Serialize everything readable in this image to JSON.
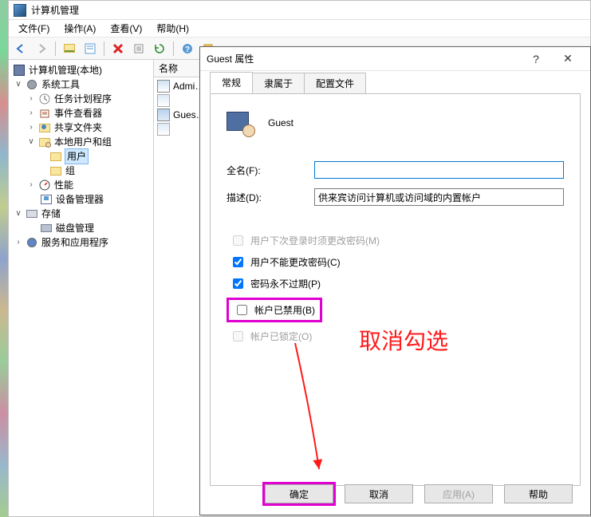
{
  "window": {
    "title": "计算机管理"
  },
  "menu": {
    "file": "文件(F)",
    "action": "操作(A)",
    "view": "查看(V)",
    "help": "帮助(H)"
  },
  "tree": {
    "root": "计算机管理(本地)",
    "system_tools": "系统工具",
    "task_scheduler": "任务计划程序",
    "event_viewer": "事件查看器",
    "shared_folders": "共享文件夹",
    "local_users_groups": "本地用户和组",
    "users": "用户",
    "groups": "组",
    "performance": "性能",
    "device_manager": "设备管理器",
    "storage": "存储",
    "disk_mgmt": "磁盘管理",
    "services_apps": "服务和应用程序"
  },
  "list": {
    "header": "名称",
    "items": [
      "Admi…",
      "",
      "Gues…",
      ""
    ]
  },
  "dialog": {
    "title": "Guest 属性",
    "tabs": {
      "general": "常规",
      "member_of": "隶属于",
      "profile": "配置文件"
    },
    "username": "Guest",
    "fullname_label": "全名(F):",
    "fullname_value": "",
    "desc_label": "描述(D):",
    "desc_value": "供来宾访问计算机或访问域的内置帐户",
    "chk_must_change": "用户下次登录时须更改密码(M)",
    "chk_cannot_change": "用户不能更改密码(C)",
    "chk_never_expires": "密码永不过期(P)",
    "chk_disabled": "帐户已禁用(B)",
    "chk_locked": "帐户已锁定(O)",
    "btn_ok": "确定",
    "btn_cancel": "取消",
    "btn_apply": "应用(A)",
    "btn_help": "帮助"
  },
  "annotation": {
    "text": "取消勾选"
  }
}
